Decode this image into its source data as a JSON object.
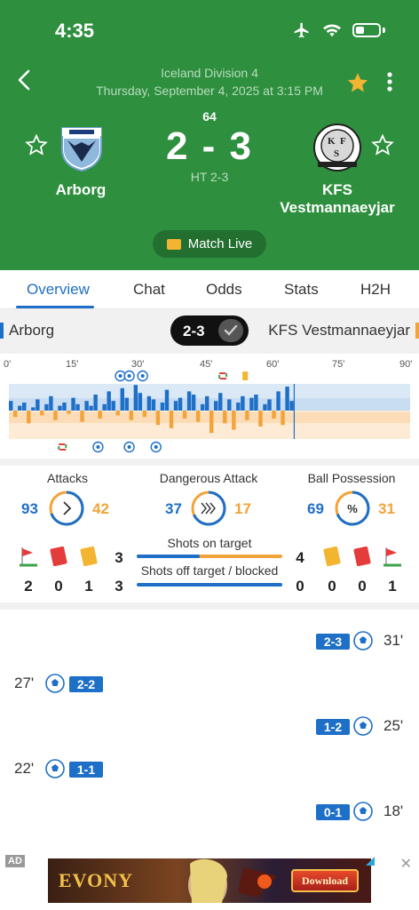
{
  "status_bar": {
    "time": "4:35"
  },
  "header": {
    "league": "Iceland Division 4",
    "date": "Thursday, September 4, 2025 at 3:15 PM",
    "minute": "64",
    "score": "2 - 3",
    "halftime": "HT 2-3",
    "live_label": "Match Live",
    "home_team": "Arborg",
    "away_team_line1": "KFS",
    "away_team_line2": "Vestmannaeyjar",
    "favorited": true
  },
  "tabs": [
    "Overview",
    "Chat",
    "Odds",
    "Stats",
    "H2H"
  ],
  "active_tab": "Overview",
  "team_row": {
    "home": "Arborg",
    "away": "KFS Vestmannaeyjar",
    "score": "2-3"
  },
  "momentum": {
    "ticks": [
      "0'",
      "15'",
      "30'",
      "45'",
      "60'",
      "75'",
      "90'"
    ],
    "current_minute": 64,
    "colors": {
      "home": "#1e6fc7",
      "away": "#f2a33a"
    },
    "home_events": [
      {
        "minute": 25,
        "type": "goal"
      },
      {
        "minute": 27,
        "type": "goal"
      },
      {
        "minute": 30,
        "type": "goal"
      },
      {
        "minute": 48,
        "type": "substitution"
      },
      {
        "minute": 53,
        "type": "yellow-card"
      }
    ],
    "away_events": [
      {
        "minute": 12,
        "type": "substitution"
      },
      {
        "minute": 20,
        "type": "goal"
      },
      {
        "minute": 27,
        "type": "goal"
      },
      {
        "minute": 33,
        "type": "goal"
      }
    ]
  },
  "stats": {
    "attacks": {
      "label": "Attacks",
      "home": "93",
      "away": "42"
    },
    "dangerous": {
      "label": "Dangerous Attack",
      "home": "37",
      "away": "17"
    },
    "possession": {
      "label": "Ball Possession",
      "home": "69",
      "away": "31",
      "icon": "%"
    },
    "shots_on": {
      "label": "Shots on target",
      "home": "3",
      "away": "4"
    },
    "shots_off": {
      "label": "Shots off target / blocked",
      "home": "3",
      "away": "0"
    },
    "home_corners": "2",
    "home_red": "0",
    "home_yellow": "1",
    "away_yellow": "0",
    "away_red": "0",
    "away_corners": "1"
  },
  "events": [
    {
      "side": "away",
      "minute": "31'",
      "score": "2-3"
    },
    {
      "side": "home",
      "minute": "27'",
      "score": "2-2"
    },
    {
      "side": "away",
      "minute": "25'",
      "score": "1-2"
    },
    {
      "side": "home",
      "minute": "22'",
      "score": "1-1"
    },
    {
      "side": "away",
      "minute": "18'",
      "score": "0-1"
    }
  ],
  "ad": {
    "tag": "AD",
    "brand": "EVONY",
    "cta": "Download"
  }
}
